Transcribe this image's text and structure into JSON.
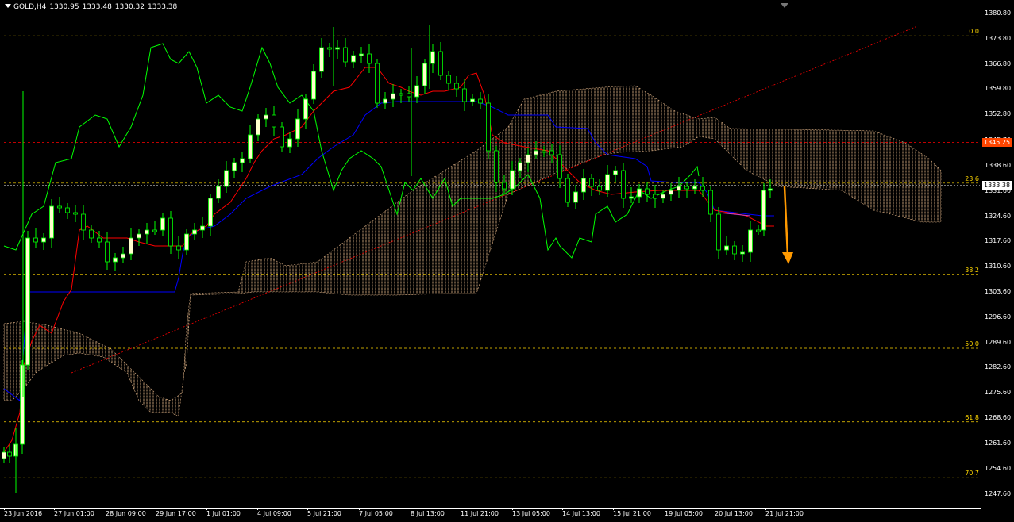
{
  "header": {
    "symbol": "GOLD,H4",
    "open": "1330.95",
    "high": "1333.48",
    "low": "1330.32",
    "close": "1333.38"
  },
  "price_axis": {
    "min": 1244.0,
    "max": 1383.0,
    "labels": [
      "1380.80",
      "1373.80",
      "1366.80",
      "1359.80",
      "1352.80",
      "1345.70",
      "1338.60",
      "1331.60",
      "1324.60",
      "1317.60",
      "1310.60",
      "1303.60",
      "1296.60",
      "1289.60",
      "1282.60",
      "1275.60",
      "1268.60",
      "1261.60",
      "1254.60",
      "1247.60"
    ],
    "red_level": {
      "text": "1345.25",
      "color": "#ff4500"
    },
    "current": {
      "text": "1333.38",
      "color": "#ffffff"
    }
  },
  "time_axis": {
    "labels": [
      "23 Jun 2016",
      "27 Jun 01:00",
      "28 Jun 09:00",
      "29 Jun 17:00",
      "1 Jul 01:00",
      "4 Jul 09:00",
      "5 Jul 21:00",
      "7 Jul 05:00",
      "8 Jul 13:00",
      "11 Jul 21:00",
      "13 Jul 05:00",
      "14 Jul 13:00",
      "15 Jul 21:00",
      "19 Jul 05:00",
      "20 Jul 13:00",
      "21 Jul 21:00"
    ]
  },
  "fibonacci": [
    {
      "label": "0.0",
      "price": 1374.8
    },
    {
      "label": "23.6",
      "price": 1334.0
    },
    {
      "label": "38.2",
      "price": 1308.6
    },
    {
      "label": "50.0",
      "price": 1288.2
    },
    {
      "label": "61.8",
      "price": 1267.8
    },
    {
      "label": "70.7",
      "price": 1252.3
    }
  ],
  "colors": {
    "background": "#000000",
    "bull_candle": "#ffffcc",
    "bear_candle": "#000000",
    "wick": "#00ff00",
    "tenkan": "#ff0000",
    "kijun": "#0000ff",
    "chikou": "#00ff00",
    "kumo": "#ffcc99",
    "fib": "#ffd700",
    "trendline": "#ff0000",
    "arrow": "#ff9900",
    "price_line": "#c0c0c0"
  }
}
